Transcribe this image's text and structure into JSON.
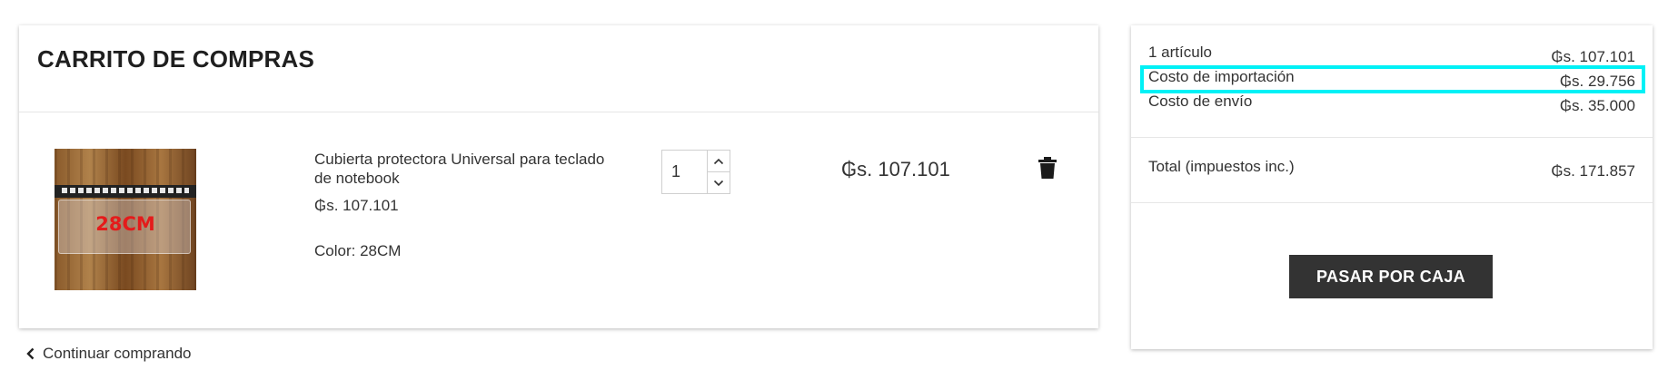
{
  "cart": {
    "title": "CARRITO DE COMPRAS",
    "item": {
      "image_alt": "Cubierta protectora Universal para teclado de notebook",
      "image_label": "28CM",
      "name": "Cubierta protectora Universal para teclado de notebook",
      "unit_price": "₲s. 107.101",
      "attribute": "Color: 28CM",
      "quantity": "1",
      "line_total": "₲s. 107.101"
    },
    "continue_label": "Continuar comprando"
  },
  "summary": {
    "rows": [
      {
        "label": "1 artículo",
        "value": "₲s. 107.101"
      },
      {
        "label": "Costo de importación",
        "value": "₲s. 29.756"
      },
      {
        "label": "Costo de envío",
        "value": "₲s. 35.000"
      }
    ],
    "total_label": "Total (impuestos inc.)",
    "total_value": "₲s. 171.857",
    "checkout_label": "PASAR POR CAJA"
  },
  "colors": {
    "highlight": "#00f1f6",
    "button_bg": "#333333",
    "text": "#333333"
  }
}
